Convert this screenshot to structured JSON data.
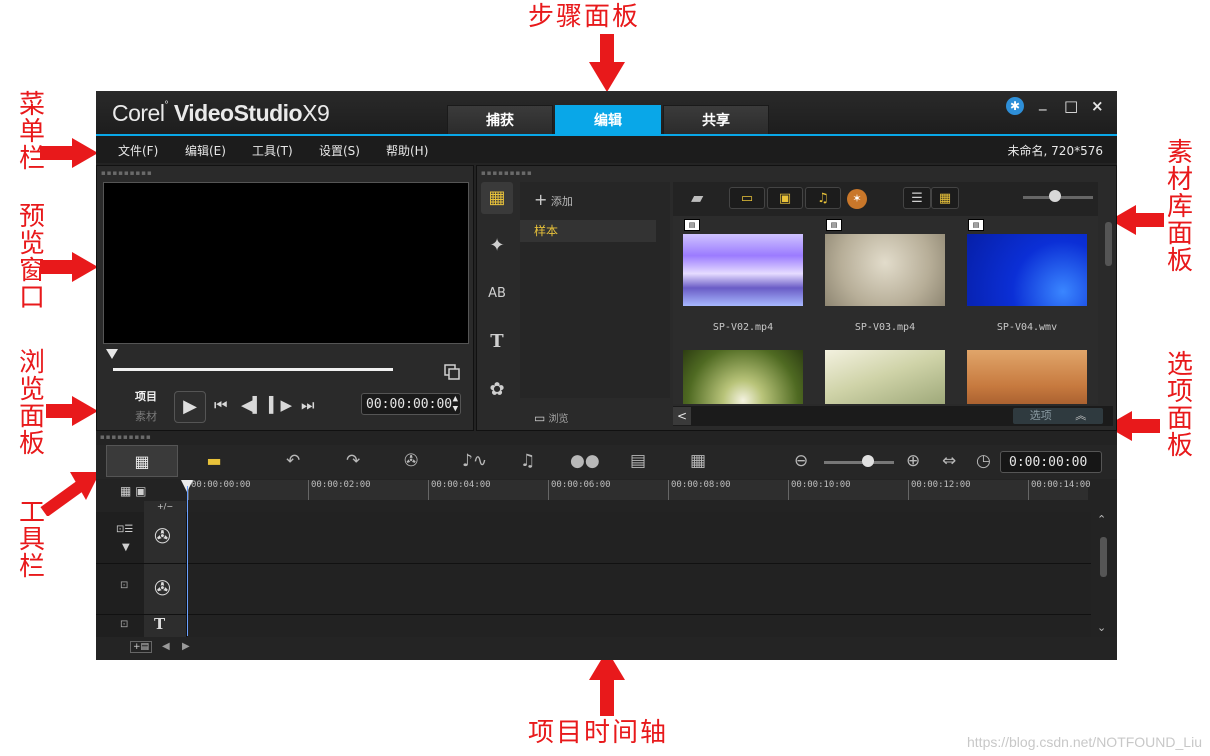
{
  "annotations": {
    "step_panel": "步骤面板",
    "menu_bar": "菜单栏",
    "preview_window": "预览窗口",
    "navigation_panel": "浏览面板",
    "toolbar": "工具栏",
    "library_panel": "素材库面板",
    "options_panel": "选项面板",
    "project_timeline": "项目时间轴"
  },
  "watermark": "https://blog.csdn.net/NOTFOUND_Liu",
  "app": {
    "logo_brand": "Corel",
    "logo_product": "VideoStudio",
    "logo_version": "X9",
    "step_tabs": [
      {
        "label": "捕获",
        "active": false
      },
      {
        "label": "编辑",
        "active": true
      },
      {
        "label": "共享",
        "active": false
      }
    ],
    "window_controls": {
      "minimize": "_",
      "maximize": "□",
      "close": "×"
    },
    "menu": [
      "文件(F)",
      "编辑(E)",
      "工具(T)",
      "设置(S)",
      "帮助(H)"
    ],
    "project_info": "未命名, 720*576"
  },
  "preview": {
    "mode_project": "项目",
    "mode_clip": "素材",
    "timecode": "00:00:00:00"
  },
  "library": {
    "add_label": "添加",
    "folder": "样本",
    "browse_label": "浏览",
    "thumbnails": [
      {
        "name": "SP-V02.mp4"
      },
      {
        "name": "SP-V03.mp4"
      },
      {
        "name": "SP-V04.wmv"
      },
      {
        "name": ""
      },
      {
        "name": ""
      },
      {
        "name": ""
      }
    ],
    "options_label": "选项"
  },
  "timeline": {
    "timecode": "0:00:00:00",
    "ruler": [
      "00:00:00:00",
      "00:00:02:00",
      "00:00:04:00",
      "00:00:06:00",
      "00:00:08:00",
      "00:00:10:00",
      "00:00:12:00",
      "00:00:14:00"
    ],
    "add_remove_label": "+/−"
  },
  "colors": {
    "accent": "#09a7e8",
    "annotation_red": "#e8191b",
    "folder_yellow": "#e8c23a"
  }
}
